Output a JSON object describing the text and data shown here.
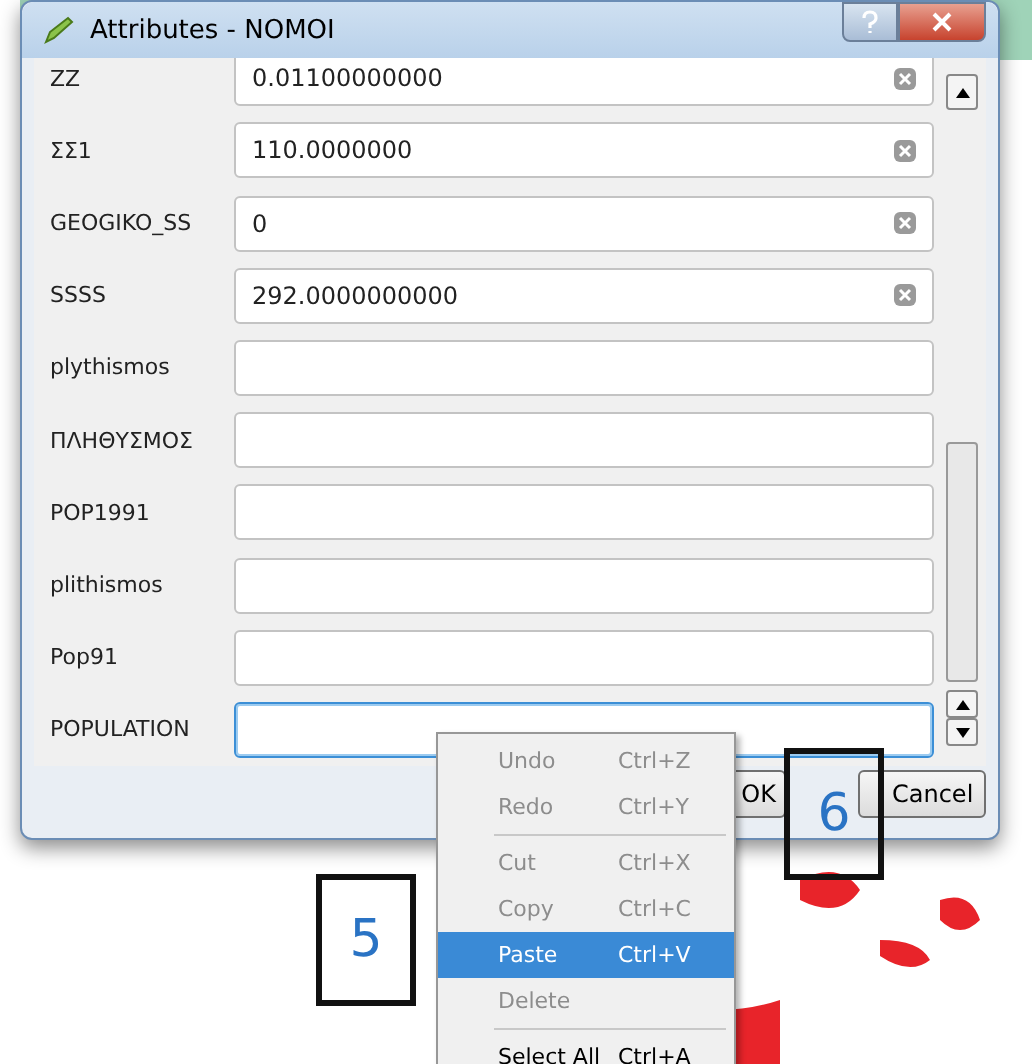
{
  "window": {
    "title": "Attributes - NOMOI"
  },
  "fields": [
    {
      "label": "ΖΖ",
      "value": "0.01100000000",
      "focused": false
    },
    {
      "label": "ΣΣ1",
      "value": "110.0000000",
      "focused": false
    },
    {
      "label": "GEOGIKO_SS",
      "value": "0",
      "focused": false
    },
    {
      "label": "SSSS",
      "value": "292.0000000000",
      "focused": false
    },
    {
      "label": "plythismos",
      "focused": false
    },
    {
      "label": "ΠΛΗΘΥΣΜΟΣ",
      "focused": false
    },
    {
      "label": "POP1991",
      "focused": false
    },
    {
      "label": "plithismos",
      "focused": false
    },
    {
      "label": "Pop91",
      "focused": false
    },
    {
      "label": "POPULATION",
      "focused": true
    }
  ],
  "buttons": [
    {
      "label": "OK"
    },
    {
      "label": "Cancel"
    }
  ],
  "context_menu": [
    {
      "label": "Undo",
      "shortcut": "Ctrl+Z",
      "selected": false,
      "disabled": true,
      "separator_before": false
    },
    {
      "label": "Redo",
      "shortcut": "Ctrl+Y",
      "selected": false,
      "disabled": true,
      "separator_before": false
    },
    {
      "label": "Cut",
      "shortcut": "Ctrl+X",
      "selected": false,
      "disabled": true,
      "separator_before": true
    },
    {
      "label": "Copy",
      "shortcut": "Ctrl+C",
      "selected": false,
      "disabled": true,
      "separator_before": false
    },
    {
      "label": "Paste",
      "shortcut": "Ctrl+V",
      "selected": true,
      "disabled": false,
      "separator_before": false
    },
    {
      "label": "Delete",
      "selected": false,
      "disabled": true,
      "separator_before": false
    },
    {
      "label": "Select All",
      "shortcut": "Ctrl+A",
      "selected": false,
      "disabled": false,
      "separator_before": true
    }
  ],
  "callouts": [
    {
      "label": "5"
    },
    {
      "label": "6"
    }
  ]
}
